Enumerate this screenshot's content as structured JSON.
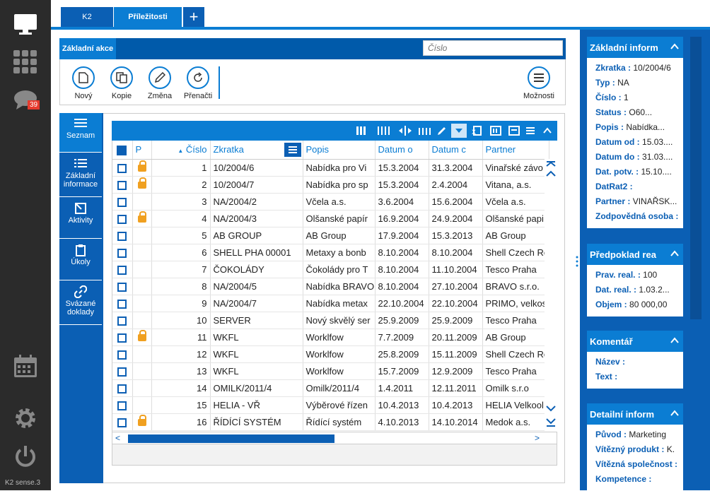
{
  "app": {
    "version": "K2 sense.3",
    "badge_count": "39"
  },
  "tabs": [
    {
      "label": "K2"
    },
    {
      "label": "Příležitosti"
    },
    {
      "label": "+"
    }
  ],
  "action_bar": {
    "label": "Základní akce",
    "search_placeholder": "Číslo"
  },
  "toolbar": {
    "buttons": [
      {
        "label": "Nový"
      },
      {
        "label": "Kopie"
      },
      {
        "label": "Změna"
      },
      {
        "label": "Přenačti"
      }
    ],
    "more_label": "Možnosti"
  },
  "side_tabs": [
    {
      "label": "Seznam"
    },
    {
      "label": "Základní informace"
    },
    {
      "label": "Aktivity"
    },
    {
      "label": "Úkoly"
    },
    {
      "label": "Svázané doklady"
    }
  ],
  "grid": {
    "columns": [
      "P",
      "Číslo",
      "Zkratka",
      "Popis",
      "Datum o",
      "Datum c",
      "Partner"
    ],
    "rows": [
      {
        "lock": true,
        "num": "1",
        "zk": "10/2004/6",
        "popis": "Nabídka pro Vi",
        "d1": "15.3.2004",
        "d2": "31.3.2004",
        "partner": "Vinařské závo"
      },
      {
        "lock": true,
        "num": "2",
        "zk": "10/2004/7",
        "popis": "Nabídka pro sp",
        "d1": "15.3.2004",
        "d2": "2.4.2004",
        "partner": "Vitana, a.s."
      },
      {
        "lock": false,
        "num": "3",
        "zk": "NA/2004/2",
        "popis": "Včela a.s.",
        "d1": "3.6.2004",
        "d2": "15.6.2004",
        "partner": "Včela a.s."
      },
      {
        "lock": true,
        "num": "4",
        "zk": "NA/2004/3",
        "popis": "Olšanské papír",
        "d1": "16.9.2004",
        "d2": "24.9.2004",
        "partner": "Olšanské papi"
      },
      {
        "lock": false,
        "num": "5",
        "zk": "AB GROUP",
        "popis": "AB Group",
        "d1": "17.9.2004",
        "d2": "15.3.2013",
        "partner": "AB Group"
      },
      {
        "lock": false,
        "num": "6",
        "zk": "SHELL PHA 00001",
        "popis": "Metaxy a bonb",
        "d1": "8.10.2004",
        "d2": "8.10.2004",
        "partner": "Shell Czech Re"
      },
      {
        "lock": false,
        "num": "7",
        "zk": "ČOKOLÁDY",
        "popis": "Čokolády pro T",
        "d1": "8.10.2004",
        "d2": "11.10.2004",
        "partner": "Tesco Praha"
      },
      {
        "lock": false,
        "num": "8",
        "zk": "NA/2004/5",
        "popis": "Nabídka BRAVO",
        "d1": "8.10.2004",
        "d2": "27.10.2004",
        "partner": "BRAVO s.r.o."
      },
      {
        "lock": false,
        "num": "9",
        "zk": "NA/2004/7",
        "popis": "Nabídka metax",
        "d1": "22.10.2004",
        "d2": "22.10.2004",
        "partner": "PRIMO, velkos"
      },
      {
        "lock": false,
        "num": "10",
        "zk": "SERVER",
        "popis": "Nový skvělý ser",
        "d1": "25.9.2009",
        "d2": "25.9.2009",
        "partner": "Tesco Praha"
      },
      {
        "lock": true,
        "num": "11",
        "zk": "WKFL",
        "popis": "Worklfow",
        "d1": "7.7.2009",
        "d2": "20.11.2009",
        "partner": "AB Group"
      },
      {
        "lock": false,
        "num": "12",
        "zk": "WKFL",
        "popis": "Worklfow",
        "d1": "25.8.2009",
        "d2": "15.11.2009",
        "partner": "Shell Czech Re"
      },
      {
        "lock": false,
        "num": "13",
        "zk": "WKFL",
        "popis": "Worklfow",
        "d1": "15.7.2009",
        "d2": "12.9.2009",
        "partner": "Tesco Praha"
      },
      {
        "lock": false,
        "num": "14",
        "zk": "OMILK/2011/4",
        "popis": "Omilk/2011/4",
        "d1": "1.4.2011",
        "d2": "12.11.2011",
        "partner": "Omilk s.r.o"
      },
      {
        "lock": false,
        "num": "15",
        "zk": "HELIA - VŘ",
        "popis": "Výběrové řízen",
        "d1": "10.4.2013",
        "d2": "10.4.2013",
        "partner": "HELIA Velkool"
      },
      {
        "lock": true,
        "num": "16",
        "zk": "ŘÍDÍCÍ SYSTÉM",
        "popis": "Řídící systém",
        "d1": "4.10.2013",
        "d2": "14.10.2014",
        "partner": "Medok a.s."
      }
    ]
  },
  "right_panel": {
    "cards": [
      {
        "title": "Základní inform",
        "rows": [
          {
            "k": "Zkratka :",
            "v": "10/2004/6"
          },
          {
            "k": "Typ :",
            "v": "NA"
          },
          {
            "k": "Číslo :",
            "v": "1"
          },
          {
            "k": "Status :",
            "v": "O60..."
          },
          {
            "k": "Popis :",
            "v": "Nabídka..."
          },
          {
            "k": "Datum od :",
            "v": "15.03...."
          },
          {
            "k": "Datum do :",
            "v": "31.03...."
          },
          {
            "k": "Dat. potv. :",
            "v": "15.10...."
          },
          {
            "k": "DatRat2 :",
            "v": ""
          },
          {
            "k": "Partner :",
            "v": "VINAŘSK..."
          },
          {
            "k": "Zodpovědná osoba :",
            "v": ""
          }
        ]
      },
      {
        "title": "Předpoklad rea",
        "rows": [
          {
            "k": "Prav. real. :",
            "v": "100"
          },
          {
            "k": "Dat. real. :",
            "v": "1.03.2..."
          },
          {
            "k": "Objem :",
            "v": "80 000,00"
          }
        ]
      },
      {
        "title": "Komentář",
        "rows": [
          {
            "k": "Název :",
            "v": ""
          },
          {
            "k": "Text :",
            "v": ""
          }
        ]
      },
      {
        "title": "Detailní inform",
        "rows": [
          {
            "k": "Původ :",
            "v": "Marketing"
          },
          {
            "k": "Vítězný produkt :",
            "v": "K."
          },
          {
            "k": "Vítězná společnost :",
            "v": ""
          },
          {
            "k": "Kompetence :",
            "v": ""
          }
        ]
      }
    ]
  }
}
